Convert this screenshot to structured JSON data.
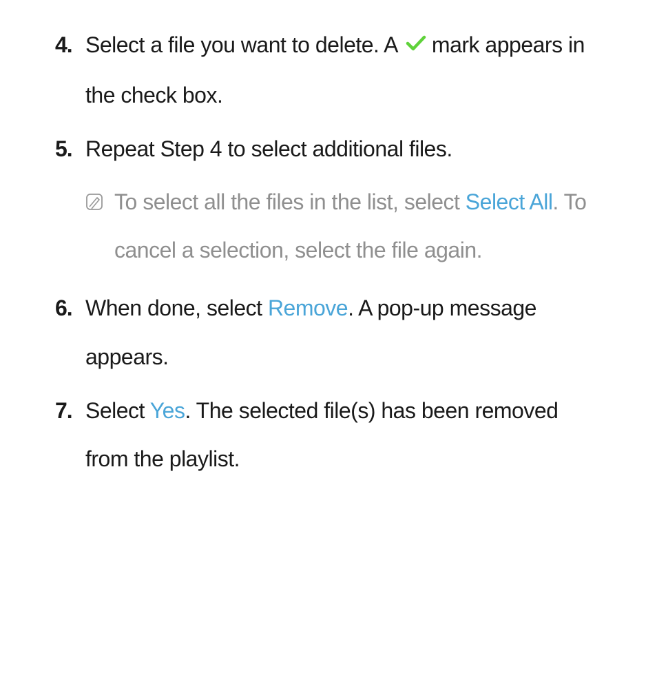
{
  "steps": {
    "s4": {
      "number": "4.",
      "text_a": "Select a file you want to delete. A ",
      "text_b": " mark appears in the check box."
    },
    "s5": {
      "number": "5.",
      "text": "Repeat Step 4 to select additional files.",
      "note_a": "To select all the files in the list, select ",
      "note_select_all": "Select All",
      "note_b": ". To cancel a selection, select the file again."
    },
    "s6": {
      "number": "6.",
      "text_a": "When done, select ",
      "remove": "Remove",
      "text_b": ". A pop-up message appears."
    },
    "s7": {
      "number": "7.",
      "text_a": "Select ",
      "yes": "Yes",
      "text_b": ". The selected file(s) has been removed from the playlist."
    }
  }
}
